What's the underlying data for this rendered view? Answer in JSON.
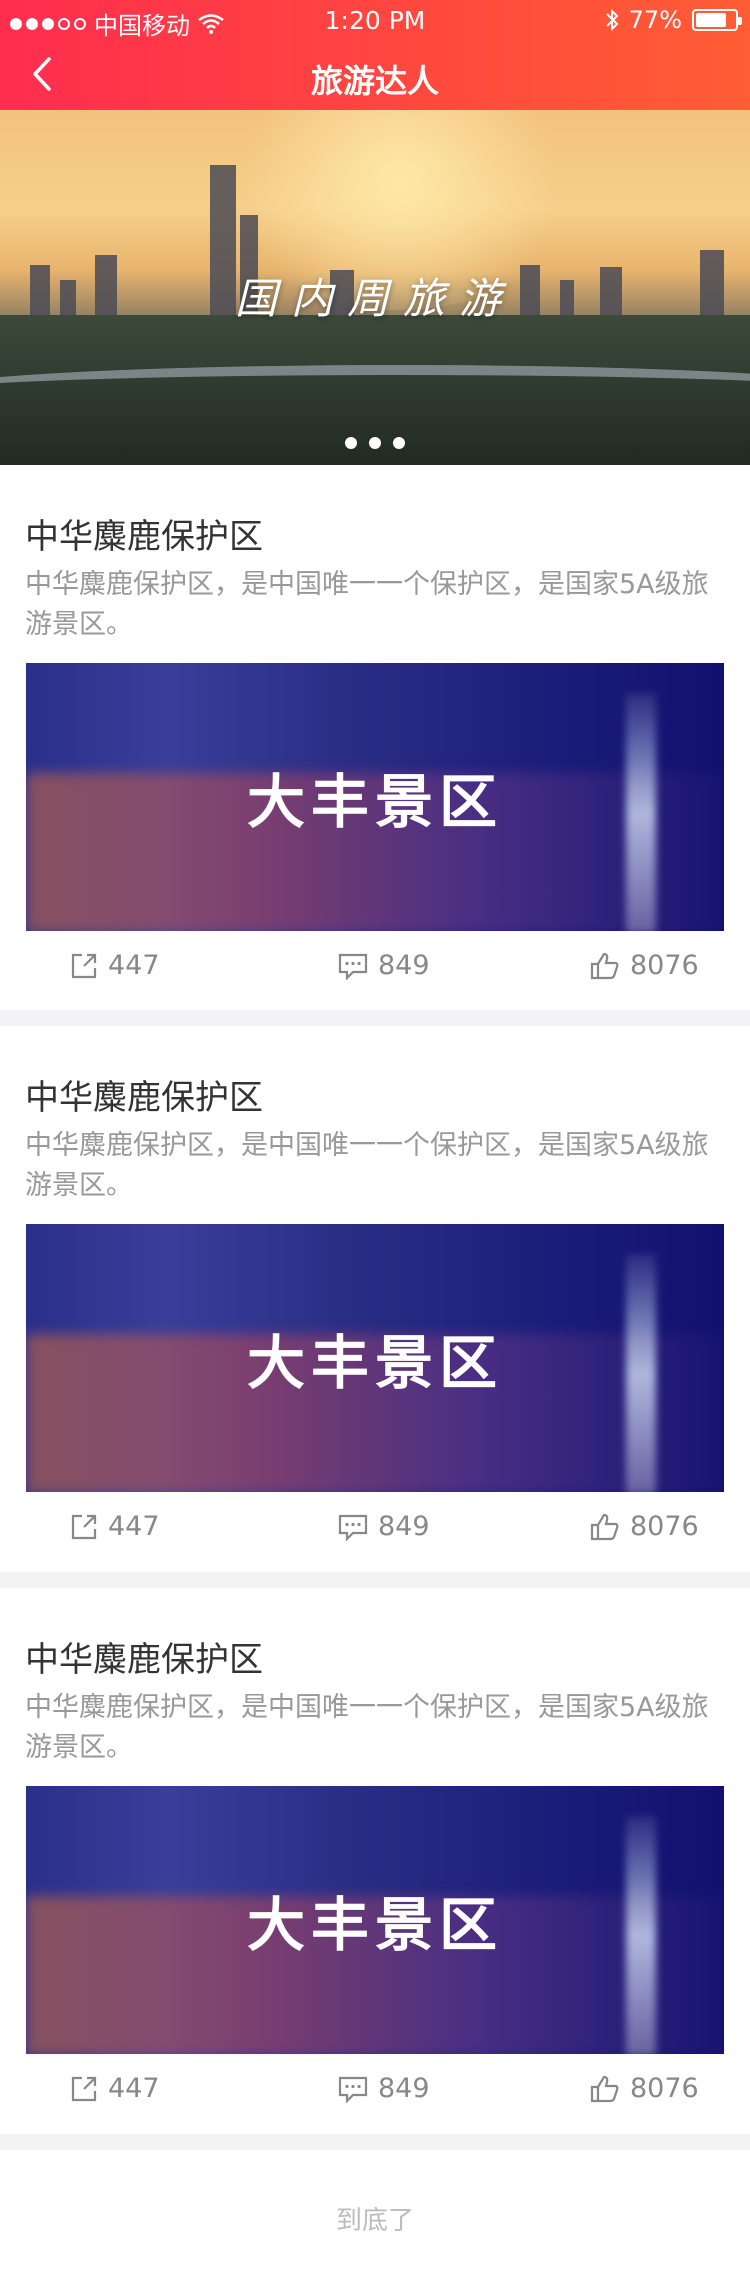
{
  "status_bar": {
    "carrier": "中国移动",
    "time": "1:20 PM",
    "battery": "77%",
    "battery_level": 0.77
  },
  "nav": {
    "title": "旅游达人",
    "back_icon": "chevron-left-icon"
  },
  "banner": {
    "caption": "国内周旅游",
    "pages": 3
  },
  "posts": [
    {
      "title": "中华麋鹿保护区",
      "description": "中华麋鹿保护区，是中国唯一一个保护区，是国家5A级旅游景区。",
      "image_text": "大丰景区",
      "shares": "447",
      "comments": "849",
      "likes": "8076"
    },
    {
      "title": "中华麋鹿保护区",
      "description": "中华麋鹿保护区，是中国唯一一个保护区，是国家5A级旅游景区。",
      "image_text": "大丰景区",
      "shares": "447",
      "comments": "849",
      "likes": "8076"
    },
    {
      "title": "中华麋鹿保护区",
      "description": "中华麋鹿保护区，是中国唯一一个保护区，是国家5A级旅游景区。",
      "image_text": "大丰景区",
      "shares": "447",
      "comments": "849",
      "likes": "8076"
    }
  ],
  "footer": {
    "end_text": "到底了"
  },
  "colors": {
    "header_start": "#ff2d4f",
    "header_end": "#ff5d36",
    "muted_text": "#999999"
  }
}
